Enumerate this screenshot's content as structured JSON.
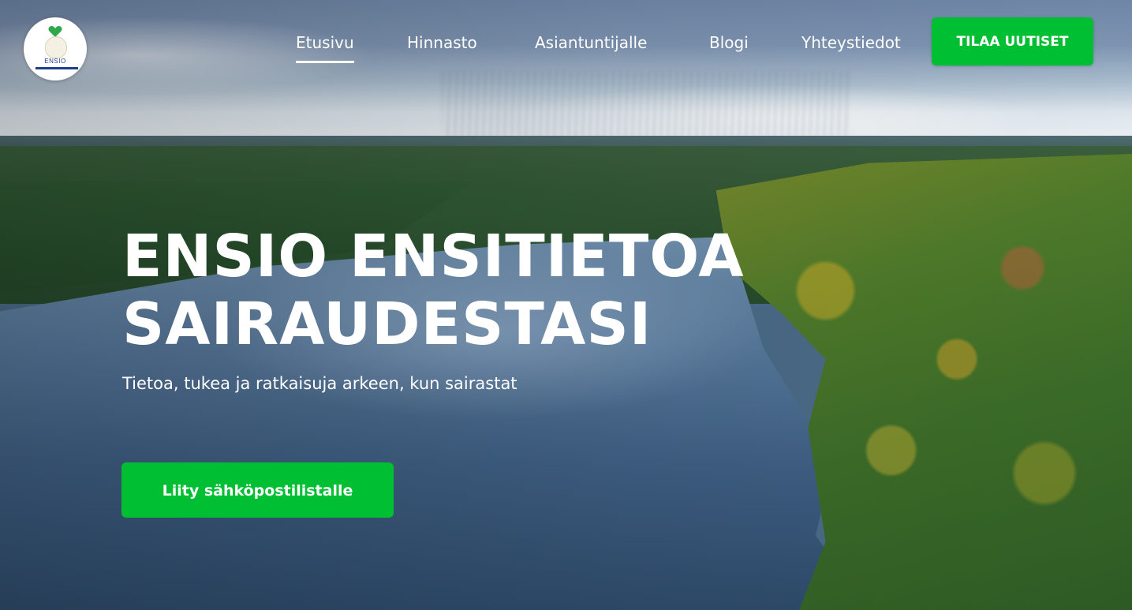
{
  "header": {
    "logo": {
      "text": "ENSIO",
      "icon": "heart-hand-icon",
      "heart_color": "#2ea84a",
      "text_color": "#1d3f8a"
    },
    "nav": [
      {
        "label": "Etusivu",
        "active": true
      },
      {
        "label": "Hinnasto",
        "active": false
      },
      {
        "label": "Asiantuntijalle",
        "active": false
      },
      {
        "label": "Blogi",
        "active": false
      },
      {
        "label": "Yhteystiedot",
        "active": false
      }
    ],
    "cta_label": "TILAA UUTISET"
  },
  "hero": {
    "title_line1": "ENSIO ENSITIETOA",
    "title_line2": "SAIRAUDESTASI",
    "subtitle": "Tietoa, tukea ja ratkaisuja arkeen, kun sairastat",
    "cta_label": "Liity sähköpostilistalle"
  },
  "colors": {
    "accent": "#00bf32",
    "text_on_image": "#ffffff"
  }
}
